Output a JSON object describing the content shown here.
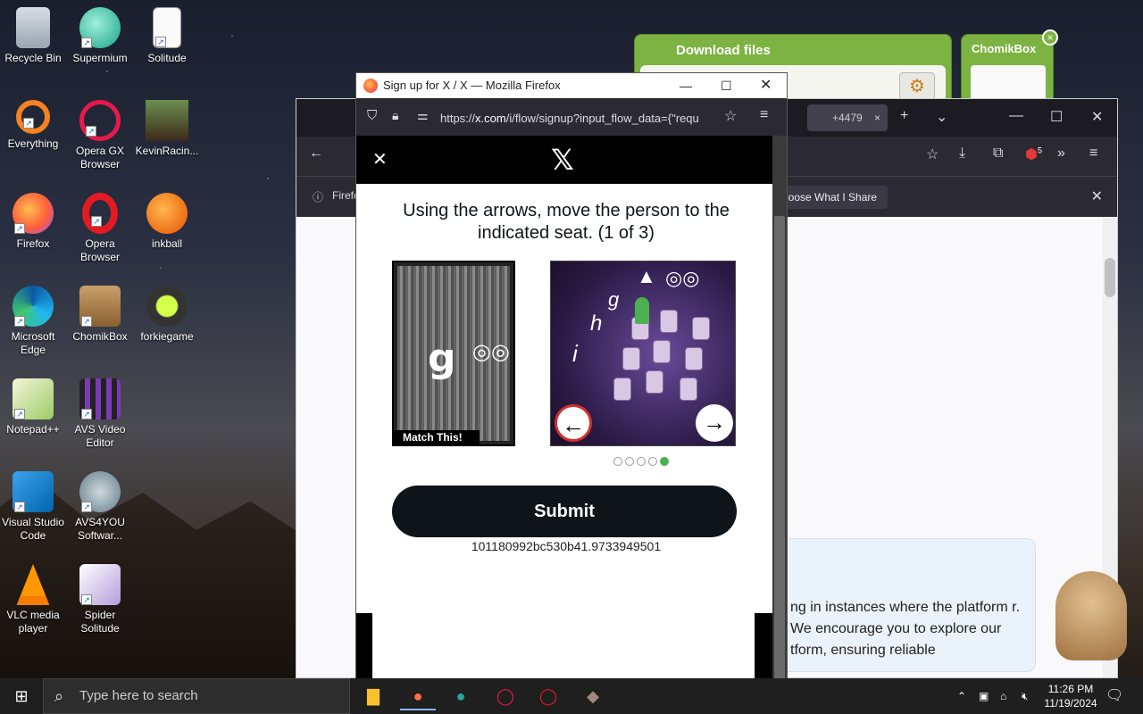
{
  "desktop": {
    "icons": [
      {
        "label": "Recycle Bin"
      },
      {
        "label": "Supermium"
      },
      {
        "label": "Solitude"
      },
      {
        "label": "Everything"
      },
      {
        "label": "Opera GX Browser"
      },
      {
        "label": "KevinRacin..."
      },
      {
        "label": "Firefox"
      },
      {
        "label": "Opera Browser"
      },
      {
        "label": "inkball"
      },
      {
        "label": "Microsoft Edge"
      },
      {
        "label": "ChomikBox"
      },
      {
        "label": "forkiegame"
      },
      {
        "label": "Notepad++"
      },
      {
        "label": "AVS Video Editor"
      },
      {
        "label": "Visual Studio Code"
      },
      {
        "label": "AVS4YOU Softwar..."
      },
      {
        "label": "VLC media player"
      },
      {
        "label": "Spider Solitude"
      }
    ]
  },
  "widgets": {
    "download_title": "Download files",
    "download_title_bold": "Download",
    "chomik_title": "ChomikBox"
  },
  "bg_window": {
    "tab_label": "+4479",
    "notif_prefix": "Firefo",
    "notif_chip": "hoose What I Share",
    "card_text": "ng in instances where the platform r. We encourage you to explore our tform, ensuring reliable",
    "badge_count": "5"
  },
  "popup": {
    "title": "Sign up for X / X — Mozilla Firefox",
    "url_prefix": "https://",
    "url_domain": "x.com",
    "url_rest": "/i/flow/signup?input_flow_data={\"requ",
    "heading": "Using the arrows, move the person to the indicated seat. (1 of 3)",
    "match_label": "Match This!",
    "match_glyph": "g",
    "puzzle_letters": [
      "g",
      "h",
      "i"
    ],
    "dots": [
      false,
      false,
      false,
      false,
      true
    ],
    "submit_label": "Submit",
    "hash": "101180992bc530b41.9733949501"
  },
  "taskbar": {
    "search_placeholder": "Type here to search",
    "time": "11:26 PM",
    "date": "11/19/2024"
  },
  "colors": {
    "accent_green": "#7cb342",
    "x_black": "#0f1419",
    "dot_active": "#4caf50",
    "arrow_red": "#d32f2f"
  }
}
